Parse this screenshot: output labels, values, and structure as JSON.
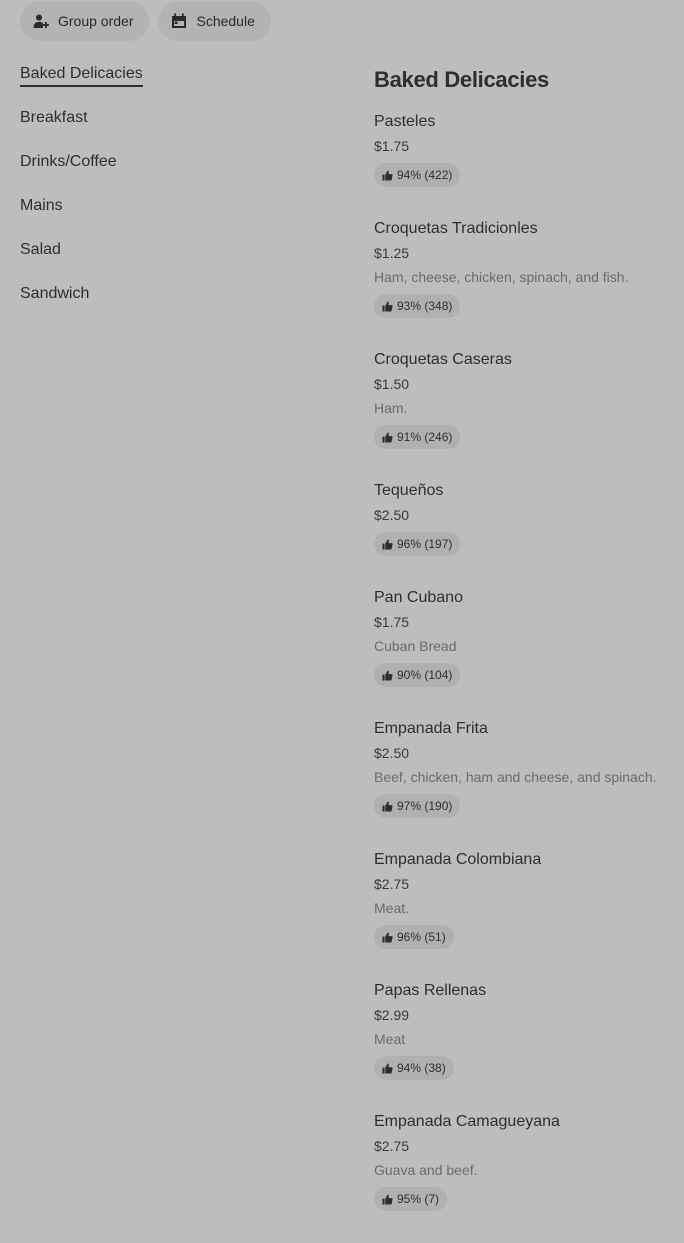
{
  "toolbar": {
    "group_order_label": "Group order",
    "schedule_label": "Schedule"
  },
  "sidebar": {
    "items": [
      {
        "label": "Baked Delicacies",
        "active": true
      },
      {
        "label": "Breakfast"
      },
      {
        "label": "Drinks/Coffee"
      },
      {
        "label": "Mains"
      },
      {
        "label": "Salad"
      },
      {
        "label": "Sandwich"
      }
    ]
  },
  "main": {
    "section_title": "Baked Delicacies",
    "items": [
      {
        "name": "Pasteles",
        "price": "$1.75",
        "desc": "",
        "rating": "94% (422)"
      },
      {
        "name": "Croquetas Tradicionles",
        "price": "$1.25",
        "desc": "Ham, cheese, chicken, spinach, and fish.",
        "rating": "93% (348)"
      },
      {
        "name": "Croquetas Caseras",
        "price": "$1.50",
        "desc": "Ham.",
        "rating": "91% (246)"
      },
      {
        "name": "Tequeños",
        "price": "$2.50",
        "desc": "",
        "rating": "96% (197)"
      },
      {
        "name": "Pan Cubano",
        "price": "$1.75",
        "desc": "Cuban Bread",
        "rating": "90% (104)"
      },
      {
        "name": "Empanada Frita",
        "price": "$2.50",
        "desc": "Beef, chicken, ham and cheese, and spinach.",
        "rating": "97% (190)"
      },
      {
        "name": "Empanada Colombiana",
        "price": "$2.75",
        "desc": "Meat.",
        "rating": "96% (51)"
      },
      {
        "name": "Papas Rellenas",
        "price": "$2.99",
        "desc": "Meat",
        "rating": "94% (38)"
      },
      {
        "name": "Empanada Camagueyana",
        "price": "$2.75",
        "desc": "Guava and beef.",
        "rating": "95% (7)"
      }
    ]
  }
}
